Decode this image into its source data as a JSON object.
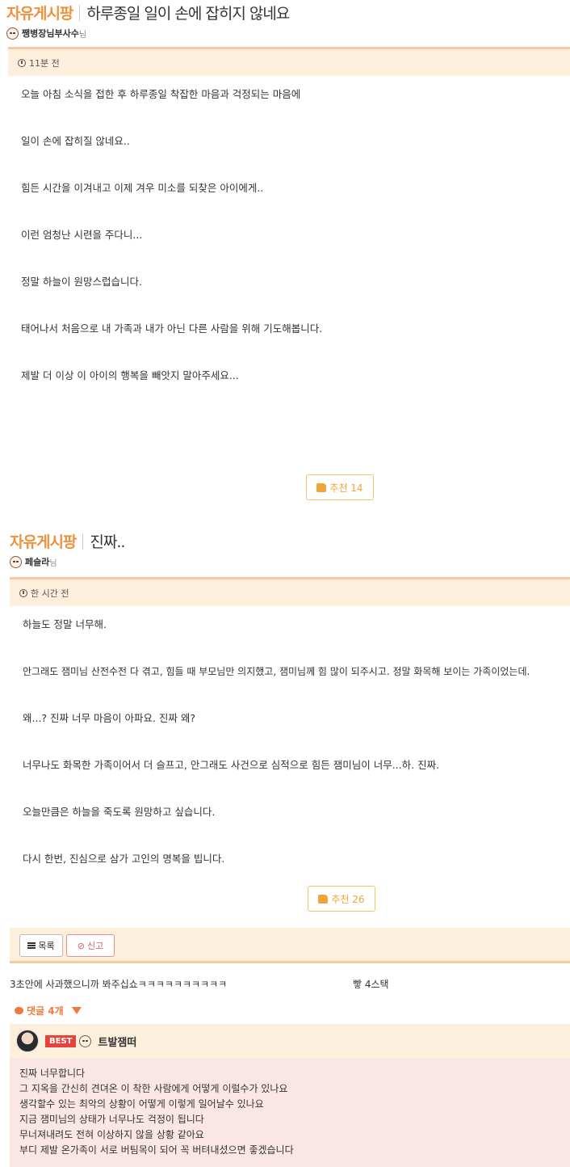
{
  "post1": {
    "board": "자유게시팡",
    "title": "하루종일 일이 손에 잡히지 않네요",
    "author": "쨍병장님부사수",
    "author_suffix": "님",
    "time": "11분 전",
    "paragraphs": [
      "오늘 아침 소식을 접한 후 하루종일 착잡한 마음과 걱정되는 마음에",
      "일이 손에 잡히질 않네요..",
      "힘든 시간을 이겨내고 이제 겨우 미소를 되찾은 아이에게..",
      "이런 엄청난 시련을 주다니...",
      "정말 하늘이 원망스럽습니다.",
      "태어나서 처음으로 내 가족과 내가 아닌 다른 사람을 위해 기도해봅니다.",
      "제발 더 이상 이 아이의 행복을 빼앗지 말아주세요..."
    ],
    "recommend": "추천 14"
  },
  "post2": {
    "board": "자유게시팡",
    "title": "진짜..",
    "author": "페슬라",
    "author_suffix": "님",
    "time": "한 시간 전",
    "paragraphs": [
      "하늘도 정말 너무해.",
      "안그래도 잼미님 산전수전 다 겪고, 힘들 때 부모님만 의지했고, 잼미님께 힘 많이 되주시고. 정말 화목해 보이는 가족이었는데.",
      "왜...? 진짜 너무 마음이 아파요. 진짜 왜?",
      "너무나도 화목한 가족이어서 더 슬프고, 안그래도 사건으로 심적으로 힘든 잼미님이 너무...하. 진짜.",
      "오늘만큼은 하늘을 죽도록 원망하고 싶습니다.",
      "다시 한번, 진심으로 삼가 고인의 명복을 빕니다."
    ],
    "recommend": "추천 26",
    "list_button": "목록",
    "report_button": "신고"
  },
  "comment_preview": {
    "text": "3초안에 사과했으니까 봐주십쇼ㅋㅋㅋㅋㅋㅋㅋㅋㅋㅋ",
    "right_text": "빻 4스택"
  },
  "comments": {
    "count_label": "댓글 4개",
    "best": {
      "badge": "BEST",
      "author": "트발잼떠",
      "lines": [
        "진짜 너무합니다",
        "그 지옥을 간신히 견뎌온 이 착한 사람에게 어떻게 이럴수가 있나요",
        "생각할수 있는 최악의 상황이 어떻게 이렇게 일어날수 있나요",
        "지금 잼미님의 상태가 너무나도 걱정이 됩니다",
        "무너져내려도 전혀 이상하지 않을 상황 같아요",
        "부디 제발 온가족이 서로 버팀목이 되어 꼭 버텨내셨으면 좋겠습니다"
      ]
    }
  },
  "colors": {
    "accent": "#f0913c",
    "timebar_bg": "#fcefdc",
    "best_bg": "#fbe6e6",
    "best_badge": "#e8423c"
  }
}
